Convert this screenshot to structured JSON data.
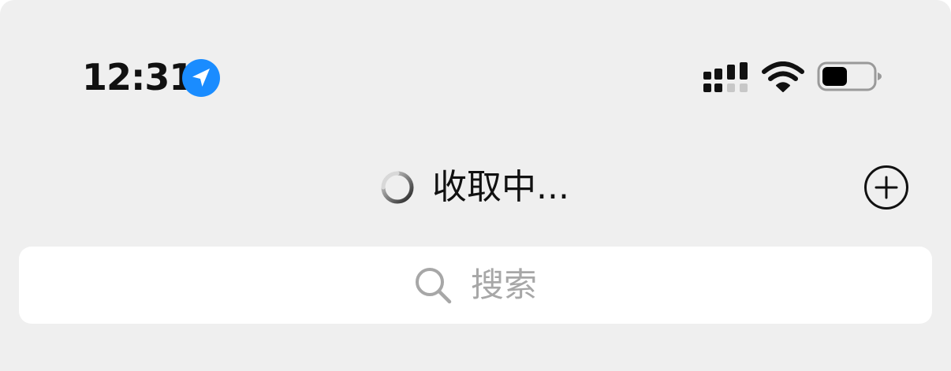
{
  "status_bar": {
    "time": "12:31",
    "location_icon": "location-arrow-icon",
    "signal_icon": "cellular-signal-icon",
    "wifi_icon": "wifi-icon",
    "battery_icon": "battery-icon",
    "battery_level": 0.5
  },
  "nav": {
    "title": "收取中...",
    "loading_icon": "spinner-icon",
    "add_icon": "plus-circle-icon"
  },
  "search": {
    "placeholder": "搜索",
    "icon": "search-icon"
  },
  "colors": {
    "background": "#efefef",
    "location_blue": "#1a8cff",
    "placeholder_gray": "#a7a7a7",
    "text_dark": "#111111"
  }
}
